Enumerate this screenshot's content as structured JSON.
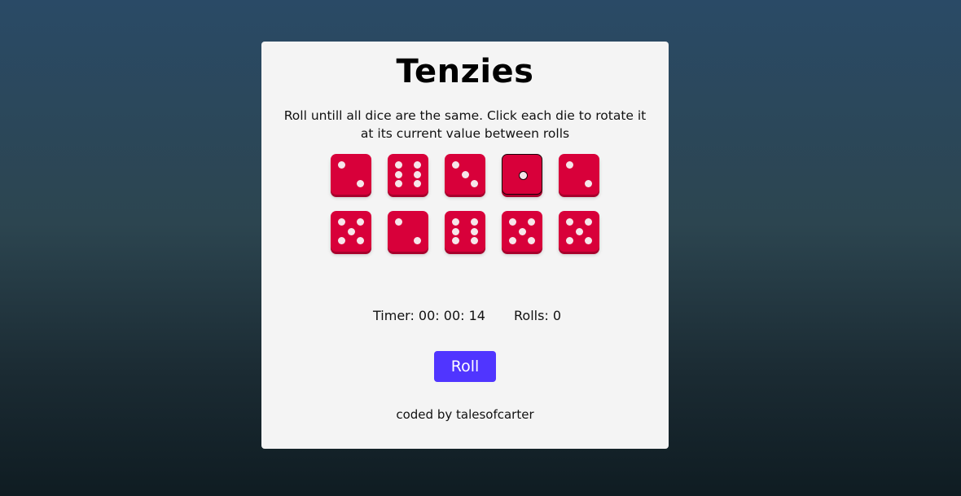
{
  "title": "Tenzies",
  "instructions": "Roll untill all dice are the same. Click each die to rotate it at its current value between rolls",
  "dice": [
    {
      "value": 2,
      "held": false
    },
    {
      "value": 6,
      "held": false
    },
    {
      "value": 3,
      "held": false
    },
    {
      "value": 1,
      "held": true
    },
    {
      "value": 2,
      "held": false
    },
    {
      "value": 5,
      "held": false
    },
    {
      "value": 2,
      "held": false
    },
    {
      "value": 6,
      "held": false
    },
    {
      "value": 5,
      "held": false
    },
    {
      "value": 5,
      "held": false
    }
  ],
  "stats": {
    "timer_text": "Timer: 00: 00: 14",
    "rolls_text": "Rolls: 0"
  },
  "roll_button_label": "Roll",
  "credit": "coded by talesofcarter",
  "colors": {
    "die": "#d8003a",
    "button": "#5035ff",
    "card": "#f4f4f4"
  }
}
